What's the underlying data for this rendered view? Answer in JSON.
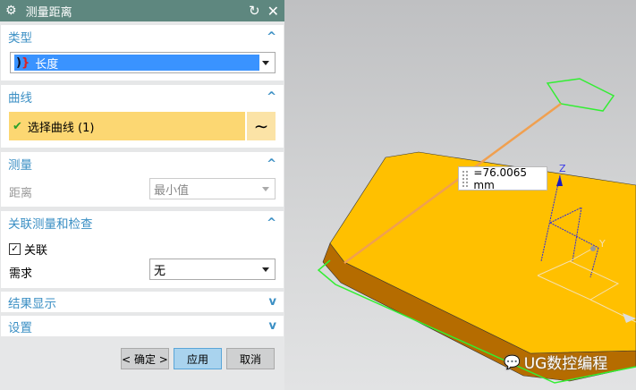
{
  "title": "测量距离",
  "sections": {
    "type": {
      "label": "类型",
      "value": "长度"
    },
    "curve": {
      "label": "曲线",
      "select_label": "选择曲线 (1)"
    },
    "measure": {
      "label": "测量",
      "distance_label": "距离",
      "distance_value": "最小值"
    },
    "assoc": {
      "label": "关联测量和检查",
      "checkbox_label": "关联",
      "checked": true,
      "req_label": "需求",
      "req_value": "无"
    },
    "result": {
      "label": "结果显示"
    },
    "settings": {
      "label": "设置"
    }
  },
  "buttons": {
    "ok": "< 确定 >",
    "apply": "应用",
    "cancel": "取消"
  },
  "viewport": {
    "measurement": "=76.0065 mm",
    "axis_z": "Z",
    "axis_y": "Y",
    "watermark": "UG数控编程"
  },
  "colors": {
    "accent": "#3b8fc4",
    "title_bg": "#5e877f",
    "part": "#ffc000"
  }
}
